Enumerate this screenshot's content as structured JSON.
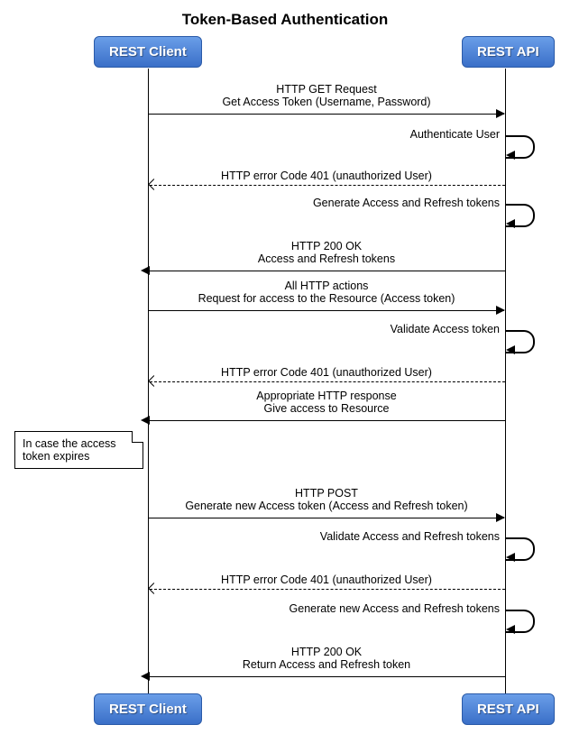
{
  "title": "Token-Based Authentication",
  "participants": {
    "left": "REST Client",
    "right": "REST API"
  },
  "messages": {
    "m1a": "HTTP GET Request",
    "m1b": "Get Access Token (Username, Password)",
    "s1": "Authenticate User",
    "m2": "HTTP error Code 401 (unauthorized User)",
    "s2": "Generate Access and Refresh tokens",
    "m3a": "HTTP 200 OK",
    "m3b": "Access and Refresh tokens",
    "m4a": "All HTTP actions",
    "m4b": "Request for access to the Resource (Access token)",
    "s3": "Validate Access token",
    "m5": "HTTP error Code 401 (unauthorized User)",
    "m6a": "Appropriate HTTP response",
    "m6b": "Give access to Resource",
    "note": "In case the access token expires",
    "m7a": "HTTP POST",
    "m7b": "Generate new Access token (Access and Refresh token)",
    "s4": "Validate Access and Refresh tokens",
    "m8": "HTTP error Code 401 (unauthorized User)",
    "s5": "Generate new Access and Refresh tokens",
    "m9a": "HTTP 200 OK",
    "m9b": "Return Access and Refresh token"
  }
}
